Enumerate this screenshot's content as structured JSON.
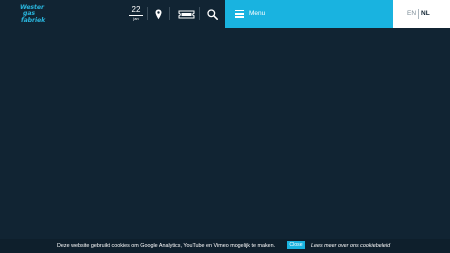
{
  "header": {
    "logo": {
      "line1": "Wester",
      "line2": "gas",
      "line3": "fabriek"
    },
    "date": {
      "day": "22",
      "month": "jan"
    },
    "icons": [
      "location-pin-icon",
      "ticket-icon",
      "search-icon"
    ]
  },
  "menu": {
    "label": "Menu"
  },
  "language": {
    "en": "EN",
    "nl": "NL",
    "active": "NL"
  },
  "cookie": {
    "text": "Deze website gebruikt cookies om Google Analytics, YouTube en Vimeo mogelijk te maken.",
    "close_label": "Close",
    "link_text": "Lees meer over ons cookiebeleid"
  },
  "colors": {
    "background": "#112433",
    "accent": "#19b3e0",
    "logo": "#29b5dd"
  }
}
